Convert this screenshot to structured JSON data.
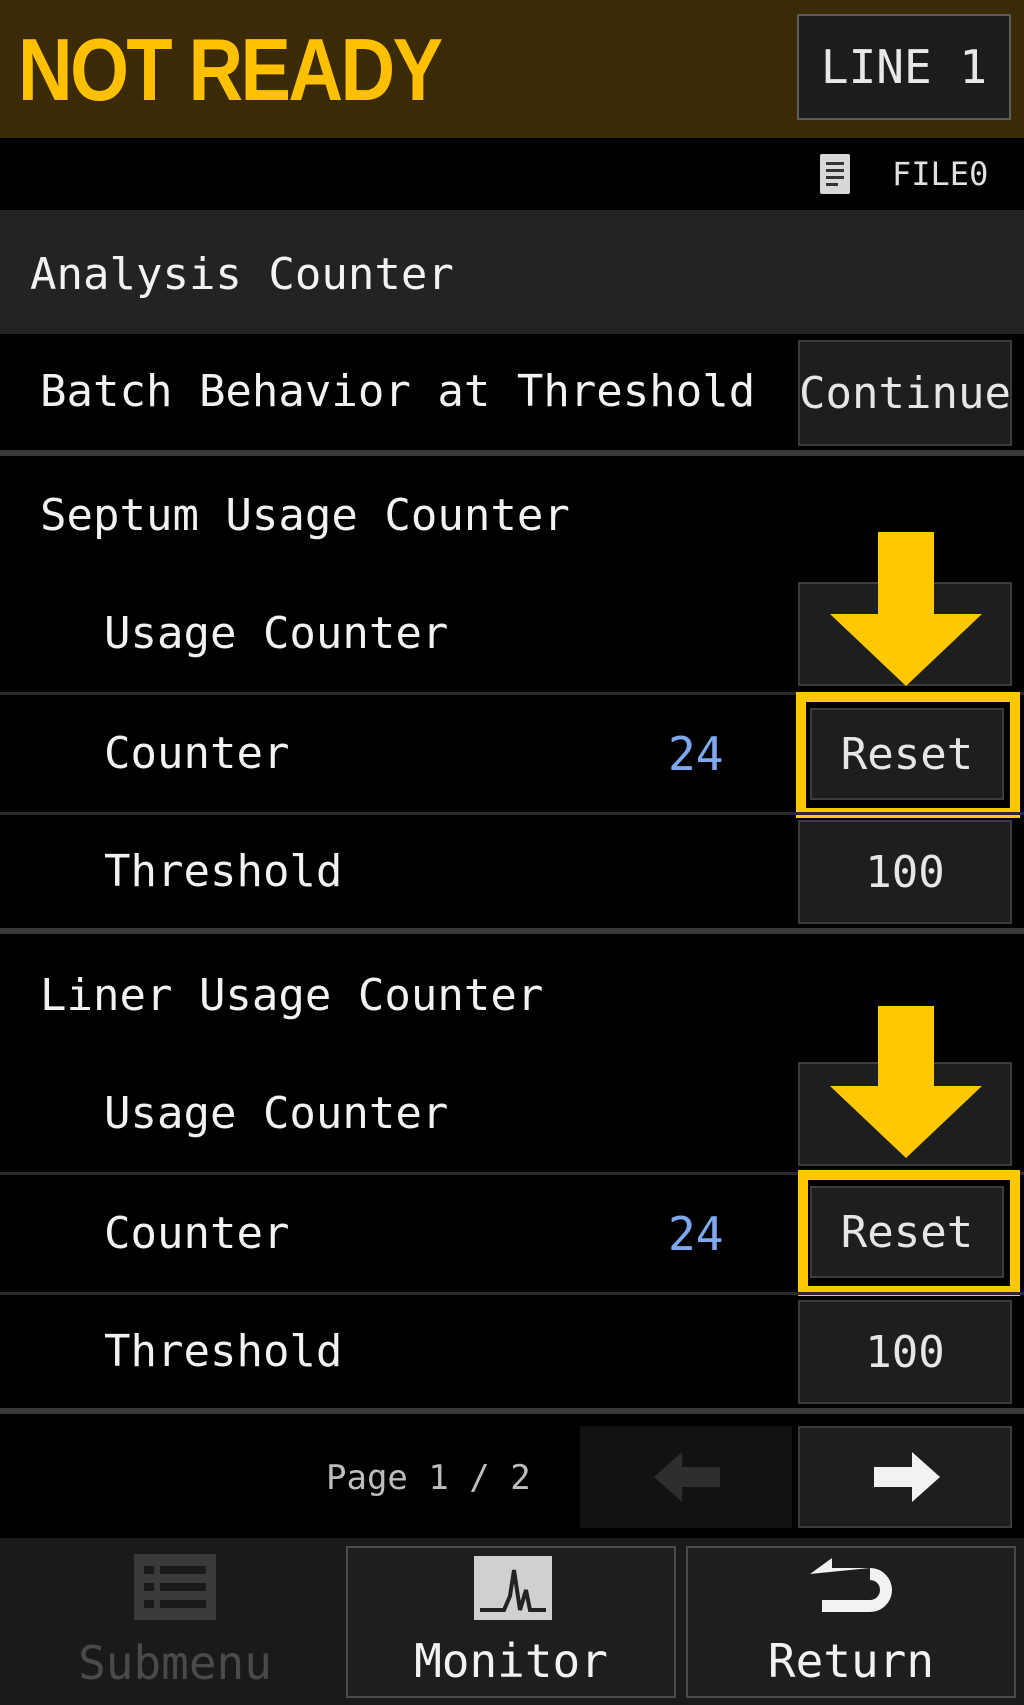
{
  "header": {
    "status": "NOT READY",
    "line_button": "LINE 1"
  },
  "file_bar": {
    "icon": "document-icon",
    "label": "FILE0"
  },
  "section": {
    "title": "Analysis Counter"
  },
  "batch": {
    "label": "Batch Behavior at Threshold",
    "value": "Continue"
  },
  "septum": {
    "title": "Septum Usage Counter",
    "usage_label": "Usage Counter",
    "counter_label": "Counter",
    "counter_value": "24",
    "reset_label": "Reset",
    "threshold_label": "Threshold",
    "threshold_value": "100"
  },
  "liner": {
    "title": "Liner Usage Counter",
    "usage_label": "Usage Counter",
    "counter_label": "Counter",
    "counter_value": "24",
    "reset_label": "Reset",
    "threshold_label": "Threshold",
    "threshold_value": "100"
  },
  "pagination": {
    "label": "Page 1 / 2",
    "prev_icon": "arrow-left-icon",
    "next_icon": "arrow-right-icon"
  },
  "nav": {
    "submenu": {
      "label": "Submenu",
      "icon": "list-icon"
    },
    "monitor": {
      "label": "Monitor",
      "icon": "monitor-chart-icon"
    },
    "return": {
      "label": "Return",
      "icon": "return-icon"
    }
  },
  "colors": {
    "accent": "#ffc000",
    "highlight": "#ffc800",
    "counter_value": "#7ea8f2",
    "header_bg": "#3a2a06",
    "panel_bg": "#222325"
  }
}
